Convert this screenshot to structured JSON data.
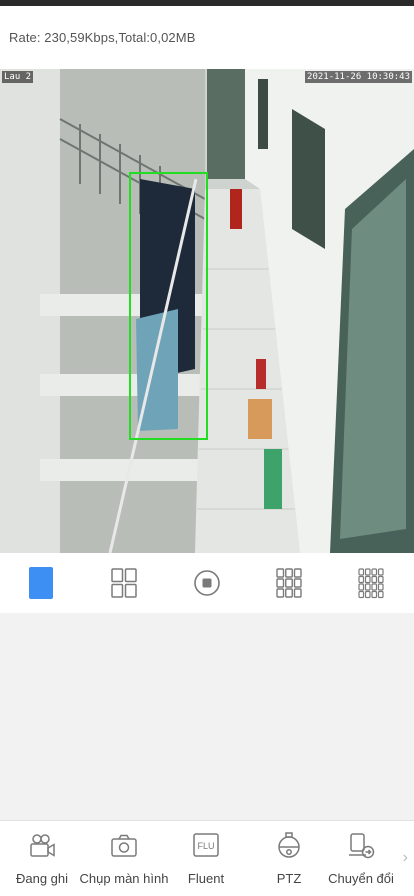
{
  "status": {
    "rate_text": "Rate: 230,59Kbps,Total:0,02MB"
  },
  "video": {
    "camera_name": "Lau 2",
    "timestamp": "2021-11-26 10:30:43",
    "detection_box_color": "#22dd22"
  },
  "layouts": [
    {
      "name": "single",
      "selected": true
    },
    {
      "name": "quad",
      "selected": false
    },
    {
      "name": "stop",
      "selected": false
    },
    {
      "name": "nine",
      "selected": false
    },
    {
      "name": "sixteen",
      "selected": false
    }
  ],
  "toolbar": {
    "record_label": "Đang ghi",
    "snapshot_label": "Chụp màn hình",
    "quality_label": "Fluent",
    "quality_icon_text": "FLU",
    "ptz_label": "PTZ",
    "switch_label": "Chuyển đổi"
  },
  "colors": {
    "accent": "#3d8ff3",
    "icon_gray": "#7a7a7a"
  }
}
